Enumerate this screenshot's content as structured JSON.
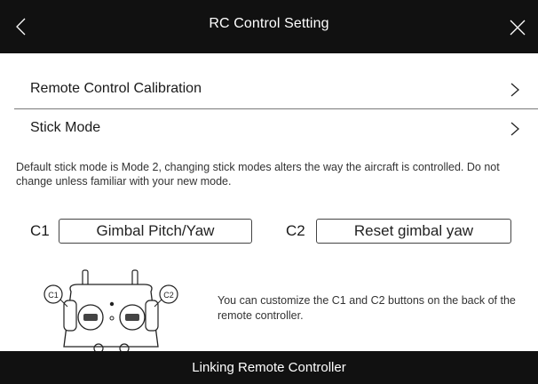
{
  "header": {
    "title": "RC Control Setting",
    "back_icon": "chevron-left-icon",
    "close_icon": "close-icon"
  },
  "settings": {
    "calibration_label": "Remote Control Calibration",
    "stick_mode_label": "Stick Mode",
    "chevron_icon": "chevron-right-icon"
  },
  "stick_mode_description": "Default stick mode is Mode 2, changing stick modes alters the way the aircraft is controlled. Do not change unless familiar with your new mode.",
  "custom_buttons": {
    "c1_label": "C1",
    "c1_value": "Gimbal Pitch/Yaw",
    "c2_label": "C2",
    "c2_value": "Reset gimbal yaw"
  },
  "illustration": {
    "c1_marker": "C1",
    "c2_marker": "C2",
    "note": "You can customize the C1 and C2 buttons on the back of the remote controller."
  },
  "footer": {
    "status_text": "Linking Remote Controller"
  },
  "colors": {
    "header_bg": "#111111",
    "footer_bg": "#111111",
    "text": "#1a1a1a",
    "divider": "#7a7a7a"
  }
}
